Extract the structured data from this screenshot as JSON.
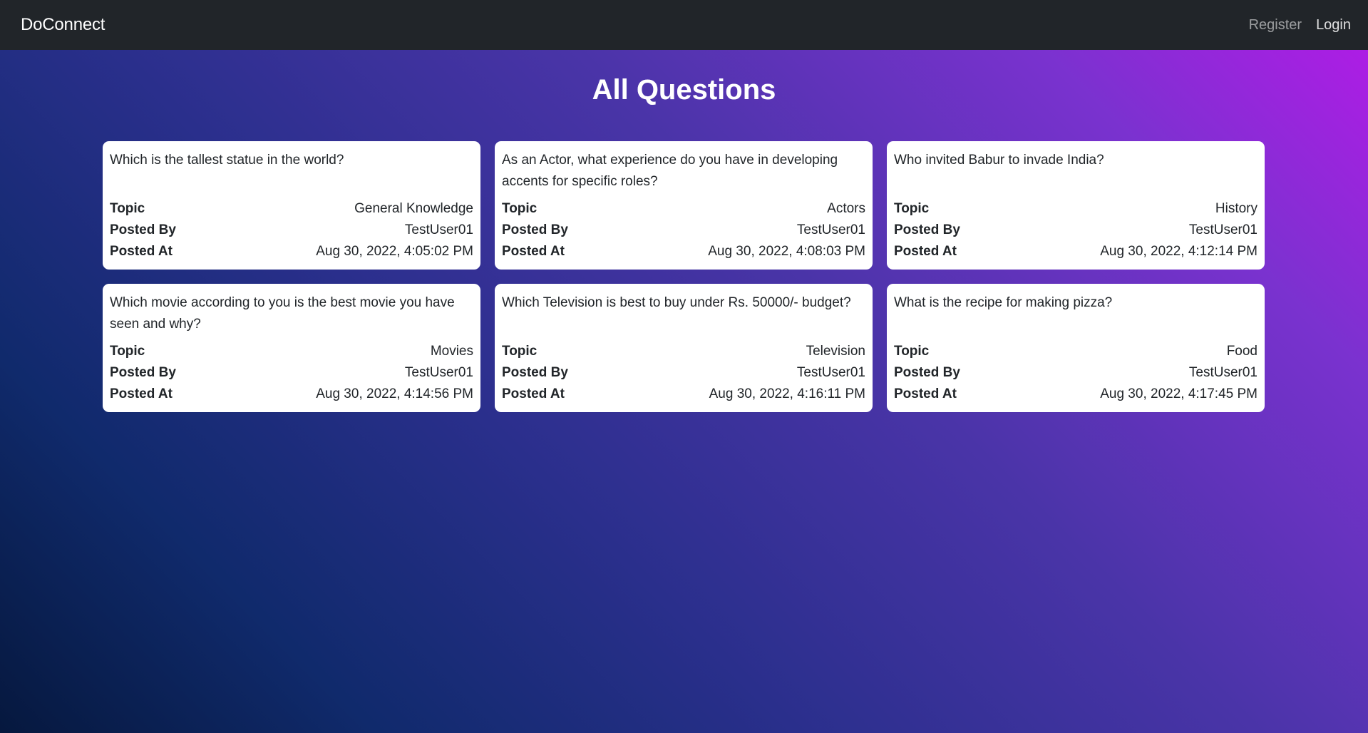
{
  "navbar": {
    "brand": "DoConnect",
    "register_label": "Register",
    "login_label": "Login"
  },
  "page": {
    "title": "All Questions"
  },
  "labels": {
    "topic": "Topic",
    "posted_by": "Posted By",
    "posted_at": "Posted At"
  },
  "questions": [
    {
      "text": "Which is the tallest statue in the world?",
      "topic": "General Knowledge",
      "posted_by": "TestUser01",
      "posted_at": "Aug 30, 2022, 4:05:02 PM"
    },
    {
      "text": "As an Actor, what experience do you have in developing accents for specific roles?",
      "topic": "Actors",
      "posted_by": "TestUser01",
      "posted_at": "Aug 30, 2022, 4:08:03 PM"
    },
    {
      "text": "Who invited Babur to invade India?",
      "topic": "History",
      "posted_by": "TestUser01",
      "posted_at": "Aug 30, 2022, 4:12:14 PM"
    },
    {
      "text": "Which movie according to you is the best movie you have seen and why?",
      "topic": "Movies",
      "posted_by": "TestUser01",
      "posted_at": "Aug 30, 2022, 4:14:56 PM"
    },
    {
      "text": "Which Television is best to buy under Rs. 50000/- budget?",
      "topic": "Television",
      "posted_by": "TestUser01",
      "posted_at": "Aug 30, 2022, 4:16:11 PM"
    },
    {
      "text": "What is the recipe for making pizza?",
      "topic": "Food",
      "posted_by": "TestUser01",
      "posted_at": "Aug 30, 2022, 4:17:45 PM"
    }
  ]
}
